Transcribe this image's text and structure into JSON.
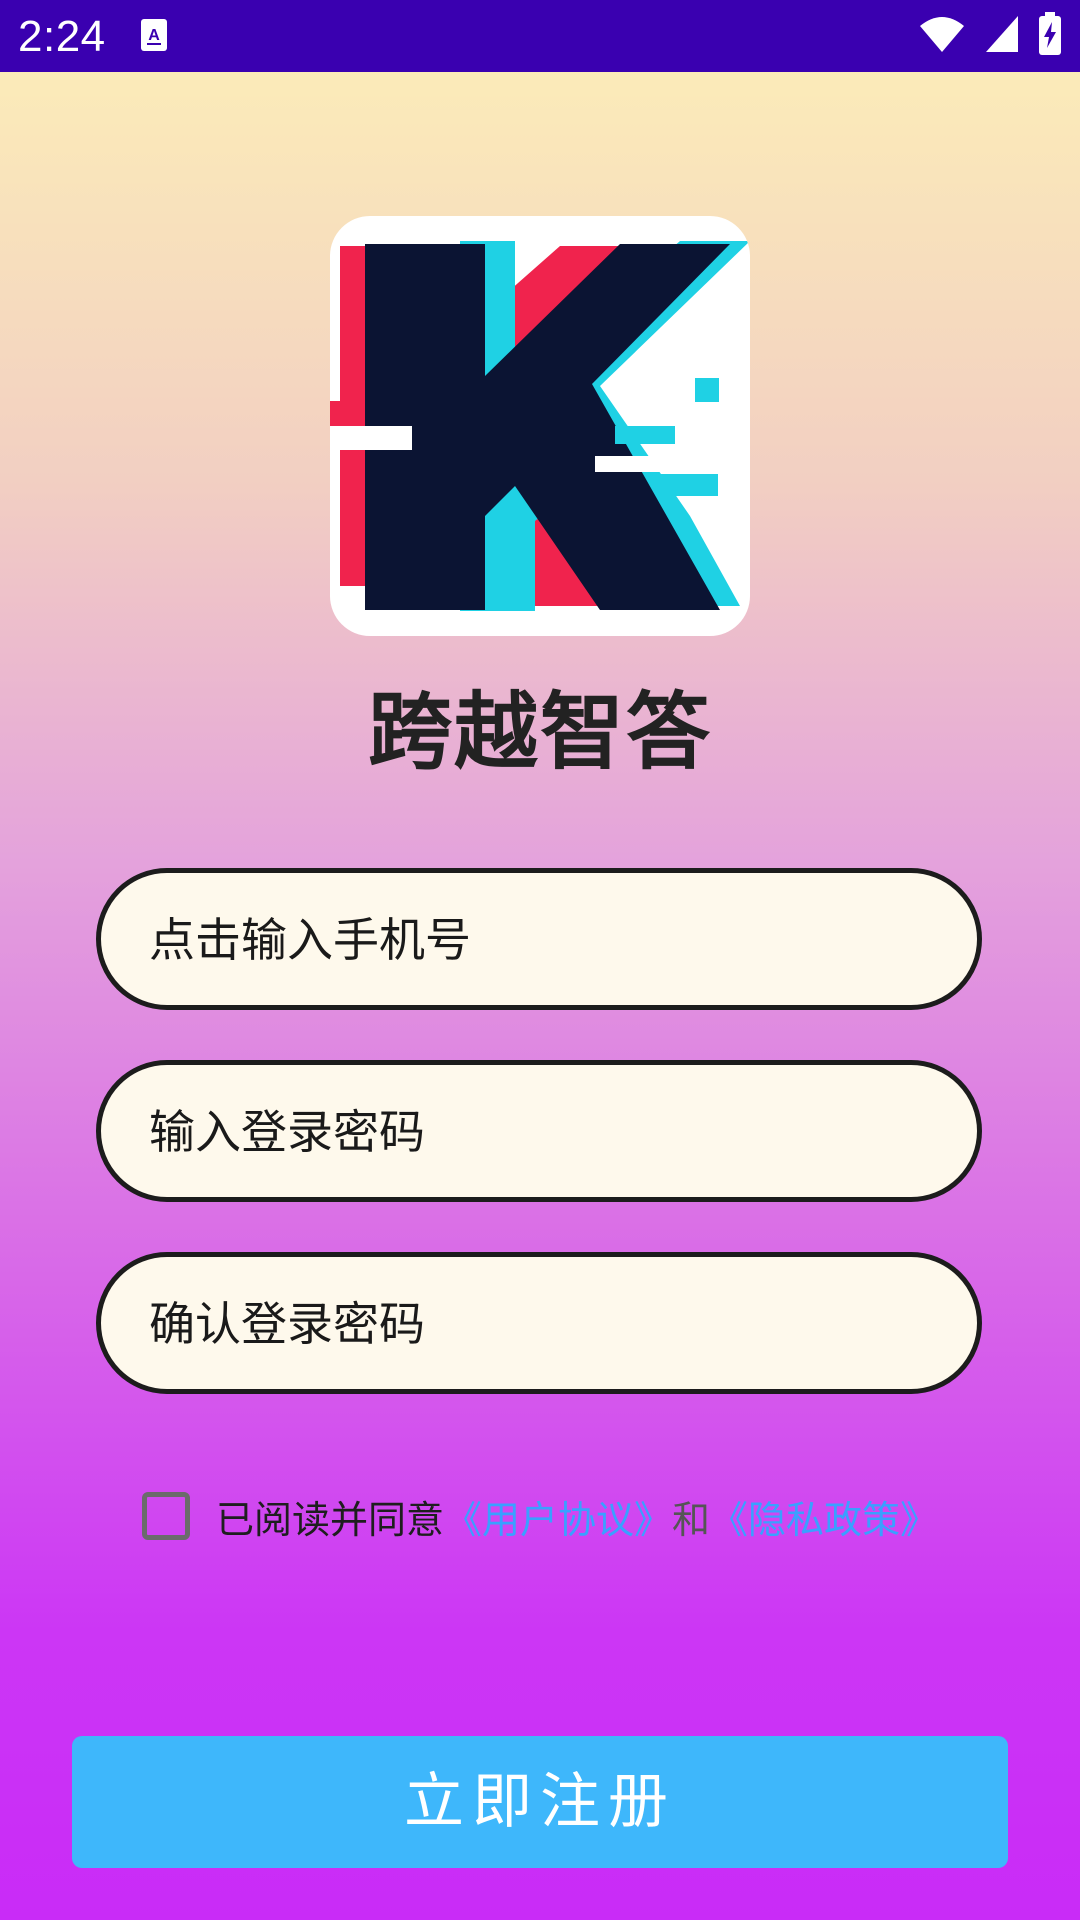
{
  "status_bar": {
    "time": "2:24",
    "icons": [
      "app-notification-icon",
      "wifi-icon",
      "signal-icon",
      "battery-charging-icon"
    ],
    "background_color": "#3a00b0"
  },
  "app": {
    "logo_icon": "k-logo-icon",
    "title": "跨越智答"
  },
  "form": {
    "phone_placeholder": "点击输入手机号",
    "password_placeholder": "输入登录密码",
    "confirm_placeholder": "确认登录密码",
    "agreement": {
      "prefix": "已阅读并同意",
      "user_agreement": "《用户协议》",
      "conjunction": "和",
      "privacy_policy": "《隐私政策》",
      "checked": false,
      "link_color": "#3aa0ff"
    },
    "register_label": "立即注册",
    "register_color": "#3eb7fb"
  }
}
